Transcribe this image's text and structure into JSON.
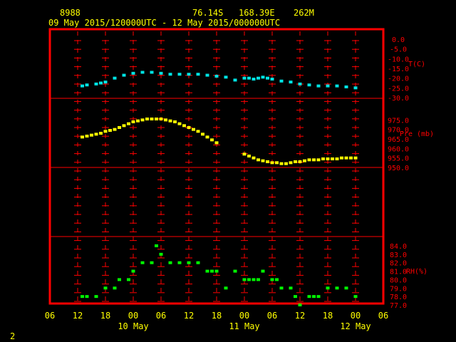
{
  "header": {
    "station": "8988",
    "lat": "76.14S",
    "lon": "168.39E",
    "elev": "262M",
    "period": "09 May 2015/120000UTC - 12 May 2015/000000UTC"
  },
  "footer": {
    "page": "2"
  },
  "colors": {
    "frame": "#ff0000",
    "grid": "#ff0000",
    "text": "#ffff00",
    "temp": "#00e5e5",
    "pres": "#ffff00",
    "rh": "#00ff00"
  },
  "x_axis": {
    "hour_ticks": [
      "06",
      "12",
      "18",
      "00",
      "06",
      "12",
      "18",
      "00",
      "06",
      "12",
      "18",
      "00",
      "06"
    ],
    "day_labels": [
      {
        "label": "10 May",
        "hour": 24
      },
      {
        "label": "11 May",
        "hour": 48
      },
      {
        "label": "12 May",
        "hour": 72
      }
    ],
    "range_hours": [
      6,
      78
    ]
  },
  "chart_data": [
    {
      "type": "scatter",
      "name": "temperature",
      "ylabel": "T(C)",
      "ylim": [
        -30,
        0
      ],
      "yticks": [
        "0.0",
        "-5.0",
        "-10.0",
        "-15.0",
        "-20.0",
        "-25.0",
        "-30.0"
      ],
      "ytick_values": [
        0,
        -5,
        -10,
        -15,
        -20,
        -25,
        -30
      ],
      "x": [
        13,
        14,
        16,
        17,
        18,
        20,
        22,
        24,
        26,
        28,
        30,
        32,
        34,
        36,
        38,
        40,
        42,
        44,
        46,
        48,
        49,
        50,
        51,
        52,
        53,
        54,
        56,
        58,
        60,
        62,
        64,
        66,
        68,
        70,
        72
      ],
      "y": [
        -24,
        -23.5,
        -23,
        -22.5,
        -22,
        -20,
        -18.5,
        -17.5,
        -17,
        -17,
        -17.5,
        -18,
        -18,
        -18,
        -18,
        -18.5,
        -19,
        -19.5,
        -21,
        -20,
        -20,
        -20.5,
        -20,
        -19.5,
        -20,
        -20.5,
        -21.5,
        -22,
        -23,
        -23.5,
        -24,
        -24,
        -24,
        -24.5,
        -25
      ]
    },
    {
      "type": "scatter",
      "name": "pressure",
      "ylabel": "Pre (mb)",
      "ylim": [
        950,
        980
      ],
      "yticks": [
        "975.0",
        "970.0",
        "965.0",
        "960.0",
        "955.0",
        "950.0"
      ],
      "ytick_values": [
        975,
        970,
        965,
        960,
        955,
        950
      ],
      "x": [
        13,
        14,
        15,
        16,
        17,
        18,
        19,
        20,
        21,
        22,
        23,
        24,
        25,
        26,
        27,
        28,
        29,
        30,
        31,
        32,
        33,
        34,
        35,
        36,
        37,
        38,
        39,
        40,
        41,
        42,
        48,
        49,
        50,
        51,
        52,
        53,
        54,
        55,
        56,
        57,
        58,
        59,
        60,
        61,
        62,
        63,
        64,
        65,
        66,
        67,
        68,
        69,
        70,
        71,
        72
      ],
      "y": [
        966,
        966.5,
        967,
        967.5,
        968,
        969,
        969.5,
        970,
        971,
        972,
        973,
        974,
        974.5,
        975,
        975.5,
        975.5,
        975.5,
        975.5,
        975,
        974.5,
        974,
        973,
        972,
        971,
        970,
        969,
        967.5,
        966,
        964.5,
        963,
        957,
        956,
        955,
        954,
        953.5,
        953,
        952.5,
        952.5,
        952,
        952,
        952.5,
        953,
        953,
        953.5,
        954,
        954,
        954,
        954.5,
        954.5,
        954.5,
        954.5,
        955,
        955,
        955,
        955
      ]
    },
    {
      "type": "scatter",
      "name": "relative_humidity",
      "ylabel": "RH(%)",
      "ylim": [
        77,
        84
      ],
      "yticks": [
        "84.0",
        "83.0",
        "82.0",
        "81.0",
        "80.0",
        "79.0",
        "78.0",
        "77.0"
      ],
      "ytick_values": [
        84,
        83,
        82,
        81,
        80,
        79,
        78,
        77
      ],
      "x": [
        13,
        14,
        16,
        18,
        20,
        21,
        23,
        24,
        26,
        28,
        29,
        30,
        32,
        34,
        36,
        38,
        40,
        41,
        42,
        44,
        46,
        48,
        49,
        50,
        51,
        52,
        54,
        55,
        56,
        58,
        59,
        60,
        62,
        63,
        64,
        66,
        68,
        70,
        72
      ],
      "y": [
        78,
        78,
        78,
        79,
        79,
        80,
        80,
        81,
        82,
        82,
        84,
        83,
        82,
        82,
        82,
        82,
        81,
        81,
        81,
        79,
        81,
        80,
        80,
        80,
        80,
        81,
        80,
        80,
        79,
        79,
        78,
        77,
        78,
        78,
        78,
        79,
        79,
        79,
        78
      ]
    }
  ]
}
